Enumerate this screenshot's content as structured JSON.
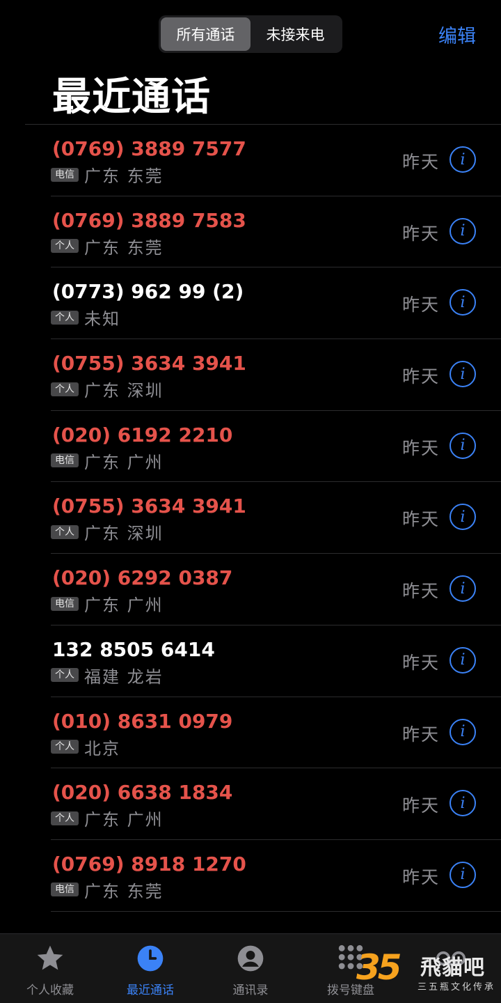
{
  "header": {
    "segments": [
      "所有通话",
      "未接来电"
    ],
    "active_segment": 0,
    "edit_label": "编辑",
    "title": "最近通话"
  },
  "calls": [
    {
      "number": "(0769) 3889 7577",
      "missed": true,
      "badge": "电信",
      "location": "广东 东莞",
      "date": "昨天"
    },
    {
      "number": "(0769) 3889 7583",
      "missed": true,
      "badge": "个人",
      "location": "广东 东莞",
      "date": "昨天"
    },
    {
      "number": "(0773) 962 99 (2)",
      "missed": false,
      "badge": "个人",
      "location": "未知",
      "date": "昨天"
    },
    {
      "number": "(0755) 3634 3941",
      "missed": true,
      "badge": "个人",
      "location": "广东 深圳",
      "date": "昨天"
    },
    {
      "number": "(020) 6192 2210",
      "missed": true,
      "badge": "电信",
      "location": "广东 广州",
      "date": "昨天"
    },
    {
      "number": "(0755) 3634 3941",
      "missed": true,
      "badge": "个人",
      "location": "广东 深圳",
      "date": "昨天"
    },
    {
      "number": "(020) 6292 0387",
      "missed": true,
      "badge": "电信",
      "location": "广东 广州",
      "date": "昨天"
    },
    {
      "number": "132 8505 6414",
      "missed": false,
      "badge": "个人",
      "location": "福建 龙岩",
      "date": "昨天"
    },
    {
      "number": "(010) 8631 0979",
      "missed": true,
      "badge": "个人",
      "location": "北京",
      "date": "昨天"
    },
    {
      "number": "(020) 6638 1834",
      "missed": true,
      "badge": "个人",
      "location": "广东 广州",
      "date": "昨天"
    },
    {
      "number": "(0769) 8918 1270",
      "missed": true,
      "badge": "电信",
      "location": "广东 东莞",
      "date": "昨天"
    }
  ],
  "tabs": [
    {
      "label": "个人收藏",
      "icon": "star-icon",
      "active": false
    },
    {
      "label": "最近通话",
      "icon": "clock-icon",
      "active": true
    },
    {
      "label": "通讯录",
      "icon": "contact-icon",
      "active": false
    },
    {
      "label": "拨号键盘",
      "icon": "keypad-icon",
      "active": false
    },
    {
      "label": "",
      "icon": "voicemail-icon",
      "active": false
    }
  ],
  "watermark": {
    "logo_text": "35",
    "brand": "飛貓吧",
    "subtitle": "三五瓶文化传承"
  },
  "colors": {
    "accent": "#3b82f6",
    "missed": "#e5534b",
    "background": "#000000",
    "secondary_text": "#8e8e93"
  }
}
